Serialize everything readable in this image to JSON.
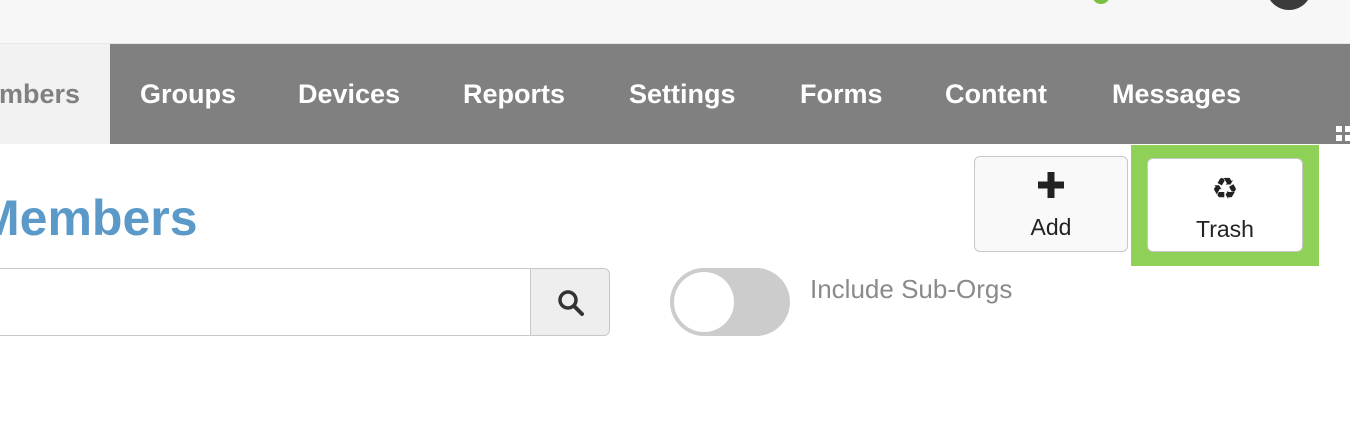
{
  "nav": {
    "tabs": [
      {
        "label": "Members",
        "active": true
      },
      {
        "label": "Groups",
        "active": false
      },
      {
        "label": "Devices",
        "active": false
      },
      {
        "label": "Reports",
        "active": false
      },
      {
        "label": "Settings",
        "active": false
      },
      {
        "label": "Forms",
        "active": false
      },
      {
        "label": "Content",
        "active": false
      },
      {
        "label": "Messages",
        "active": false
      }
    ],
    "more_icon": "grid-icon"
  },
  "page": {
    "title": "Members"
  },
  "actions": {
    "add": {
      "label": "Add",
      "icon": "plus-icon"
    },
    "trash": {
      "label": "Trash",
      "icon": "recycle-icon",
      "highlight_color": "#8fd156"
    }
  },
  "search": {
    "value": "",
    "placeholder": "",
    "button_icon": "search-icon"
  },
  "filter": {
    "include_sub_orgs_label": "Include Sub-Orgs",
    "include_sub_orgs_on": false
  },
  "colors": {
    "nav_bg": "#808080",
    "title": "#5b99c9",
    "accent_green": "#7ac142"
  }
}
